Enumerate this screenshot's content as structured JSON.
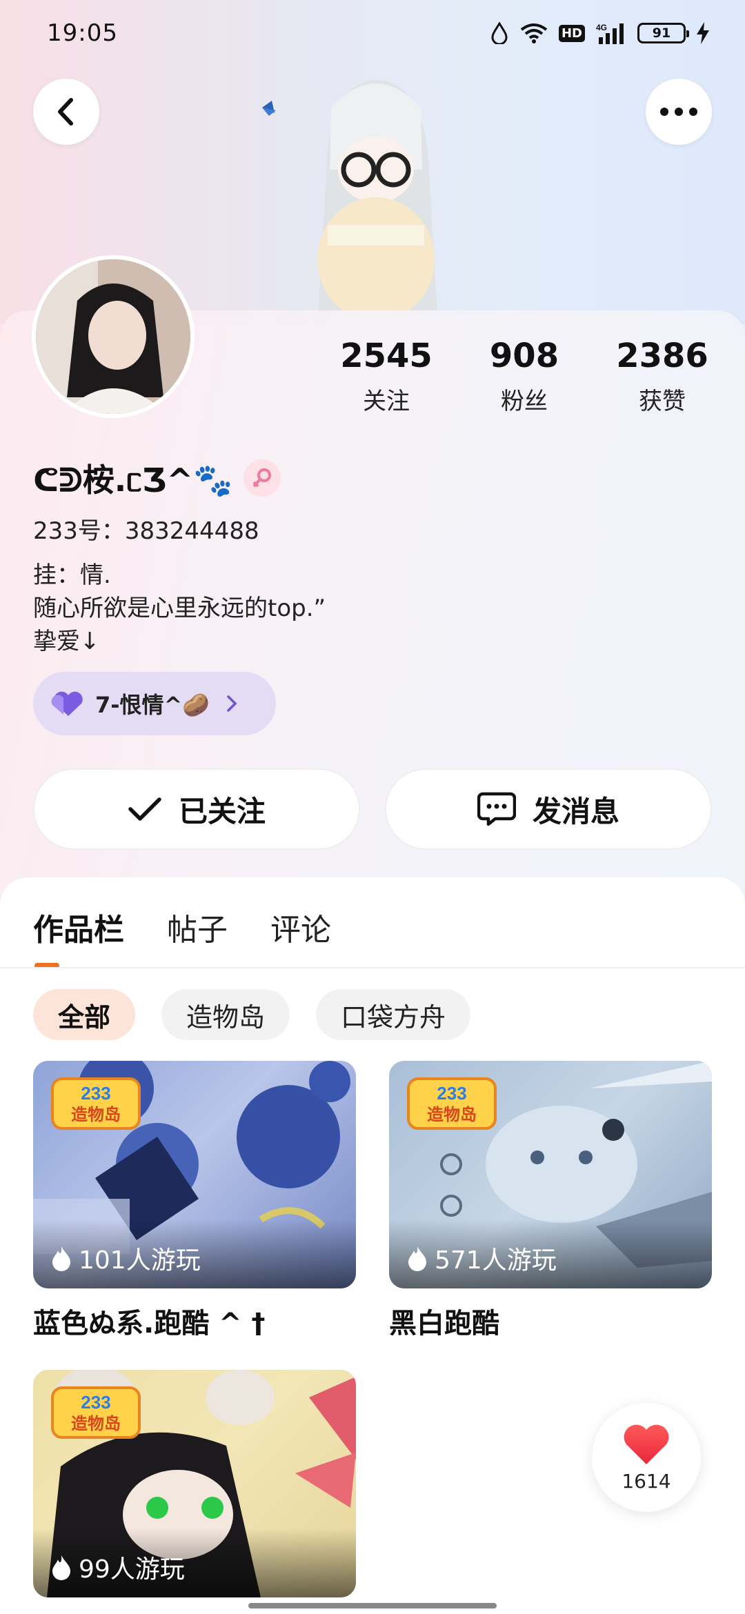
{
  "status_bar": {
    "time": "19:05",
    "network": "4G",
    "hd": "HD",
    "battery": "91"
  },
  "profile": {
    "stats": [
      {
        "value": "2545",
        "label": "关注"
      },
      {
        "value": "908",
        "label": "粉丝"
      },
      {
        "value": "2386",
        "label": "获赞"
      }
    ],
    "name": "ᕦᕲ桉.ᥴƷ^🐾",
    "gender_icon": "female-icon",
    "uid": "233号：383244488",
    "bio_lines": [
      "挂：情.",
      "随心所欲是心里永远的top.”",
      "挚爱↓"
    ],
    "tag": {
      "label": "7-恨情^🥔",
      "icon": "purple-heart-icon"
    },
    "actions": {
      "follow_label": "已关注",
      "message_label": "发消息"
    }
  },
  "tabs": [
    {
      "label": "作品栏",
      "active": true
    },
    {
      "label": "帖子",
      "active": false
    },
    {
      "label": "评论",
      "active": false
    }
  ],
  "filters": [
    {
      "label": "全部",
      "active": true
    },
    {
      "label": "造物岛",
      "active": false
    },
    {
      "label": "口袋方舟",
      "active": false
    }
  ],
  "works": [
    {
      "title": "蓝色ぬ系.跑酷 ^ †",
      "plays": "101人游玩",
      "badge": "233造物岛"
    },
    {
      "title": "黑白跑酷",
      "plays": "571人游玩",
      "badge": "233造物岛"
    },
    {
      "title": "",
      "plays": "99人游玩",
      "badge": "233造物岛"
    }
  ],
  "like_fab": {
    "count": "1614"
  },
  "colors": {
    "accent": "#f07023",
    "tag_bg": "#e4dcf5",
    "chip_active": "#fde4d8"
  }
}
